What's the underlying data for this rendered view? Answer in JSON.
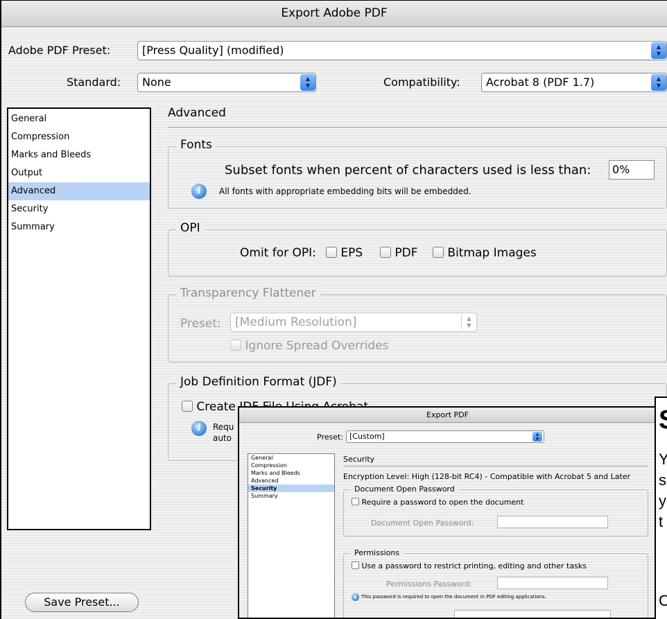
{
  "window": {
    "title": "Export Adobe PDF"
  },
  "preset": {
    "label": "Adobe PDF Preset:",
    "value": "[Press Quality] (modified)"
  },
  "standard": {
    "label": "Standard:",
    "value": "None"
  },
  "compatibility": {
    "label": "Compatibility:",
    "value": "Acrobat 8 (PDF 1.7)"
  },
  "sidebar": {
    "items": [
      {
        "label": "General"
      },
      {
        "label": "Compression"
      },
      {
        "label": "Marks and Bleeds"
      },
      {
        "label": "Output"
      },
      {
        "label": "Advanced",
        "selected": true
      },
      {
        "label": "Security"
      },
      {
        "label": "Summary"
      }
    ]
  },
  "section": {
    "title": "Advanced"
  },
  "fonts": {
    "title": "Fonts",
    "subset_label": "Subset fonts when percent of characters used is less than:",
    "subset_value": "0%",
    "note": "All fonts with appropriate embedding bits will be embedded."
  },
  "opi": {
    "title": "OPI",
    "omit_label": "Omit for OPI:",
    "options": [
      "EPS",
      "PDF",
      "Bitmap Images"
    ]
  },
  "flattener": {
    "title": "Transparency Flattener",
    "preset_label": "Preset:",
    "preset_value": "[Medium Resolution]",
    "ignore_label": "Ignore Spread Overrides"
  },
  "jdf": {
    "title": "Job Definition Format (JDF)",
    "create_label": "Create JDF File Using Acrobat",
    "note_line1": "Requ",
    "note_line2": "auto"
  },
  "save_button": "Save Preset...",
  "overlay": {
    "title": "Export PDF",
    "preset_label": "Preset:",
    "preset_value": "[Custom]",
    "sidebar": [
      "General",
      "Compression",
      "Marks and Bleeds",
      "Advanced",
      "Security",
      "Summary"
    ],
    "selected_index": 4,
    "section_title": "Security",
    "encryption": "Encryption Level: High (128-bit RC4) - Compatible with Acrobat 5 and Later",
    "doc_open": {
      "title": "Document Open Password",
      "require_label": "Require a password to open the document",
      "password_label": "Document Open Password:"
    },
    "permissions": {
      "title": "Permissions",
      "use_label": "Use a password to restrict printing, editing and other tasks",
      "password_label": "Permissions Password:",
      "note": "This password is required to open the document in PDF editing applications."
    }
  },
  "right_panel": {
    "heading": "S",
    "lines": [
      "Y",
      "s",
      "y",
      "t"
    ],
    "bottom": "C"
  }
}
